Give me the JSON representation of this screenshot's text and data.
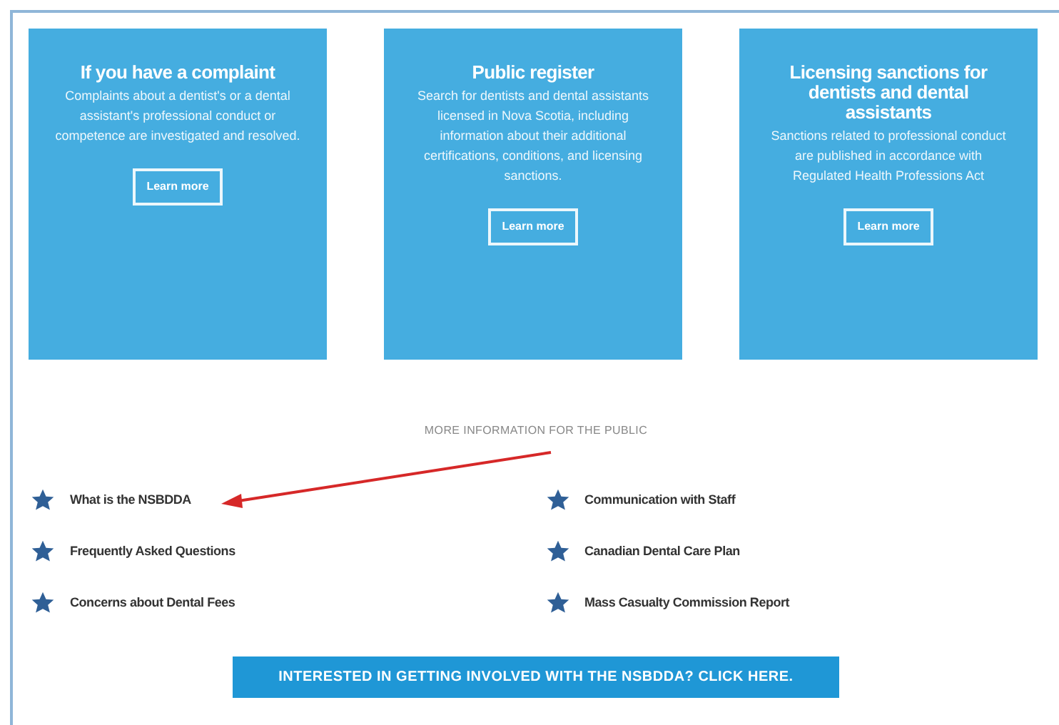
{
  "cards": [
    {
      "title": "If you have a complaint",
      "text": "Complaints about a dentist's or a dental assistant's professional conduct or competence are investigated and resolved.",
      "button": "Learn more"
    },
    {
      "title": "Public register",
      "text": "Search for dentists and dental assistants licensed in Nova Scotia, including information about their additional certifications, conditions, and licensing sanctions.",
      "button": "Learn more"
    },
    {
      "title": "Licensing sanctions for dentists and dental assistants",
      "text": "Sanctions related to professional conduct are published in accordance with Regulated Health Professions Act",
      "button": "Learn more"
    }
  ],
  "section_heading": "MORE INFORMATION FOR THE PUBLIC",
  "links": [
    {
      "label": "What is the NSBDDA"
    },
    {
      "label": "Communication with Staff"
    },
    {
      "label": "Frequently Asked Questions"
    },
    {
      "label": "Canadian Dental Care Plan"
    },
    {
      "label": "Concerns about Dental Fees"
    },
    {
      "label": "Mass Casualty Commission Report"
    }
  ],
  "banner": "INTERESTED IN GETTING INVOLVED WITH THE NSBDDA? CLICK HERE."
}
